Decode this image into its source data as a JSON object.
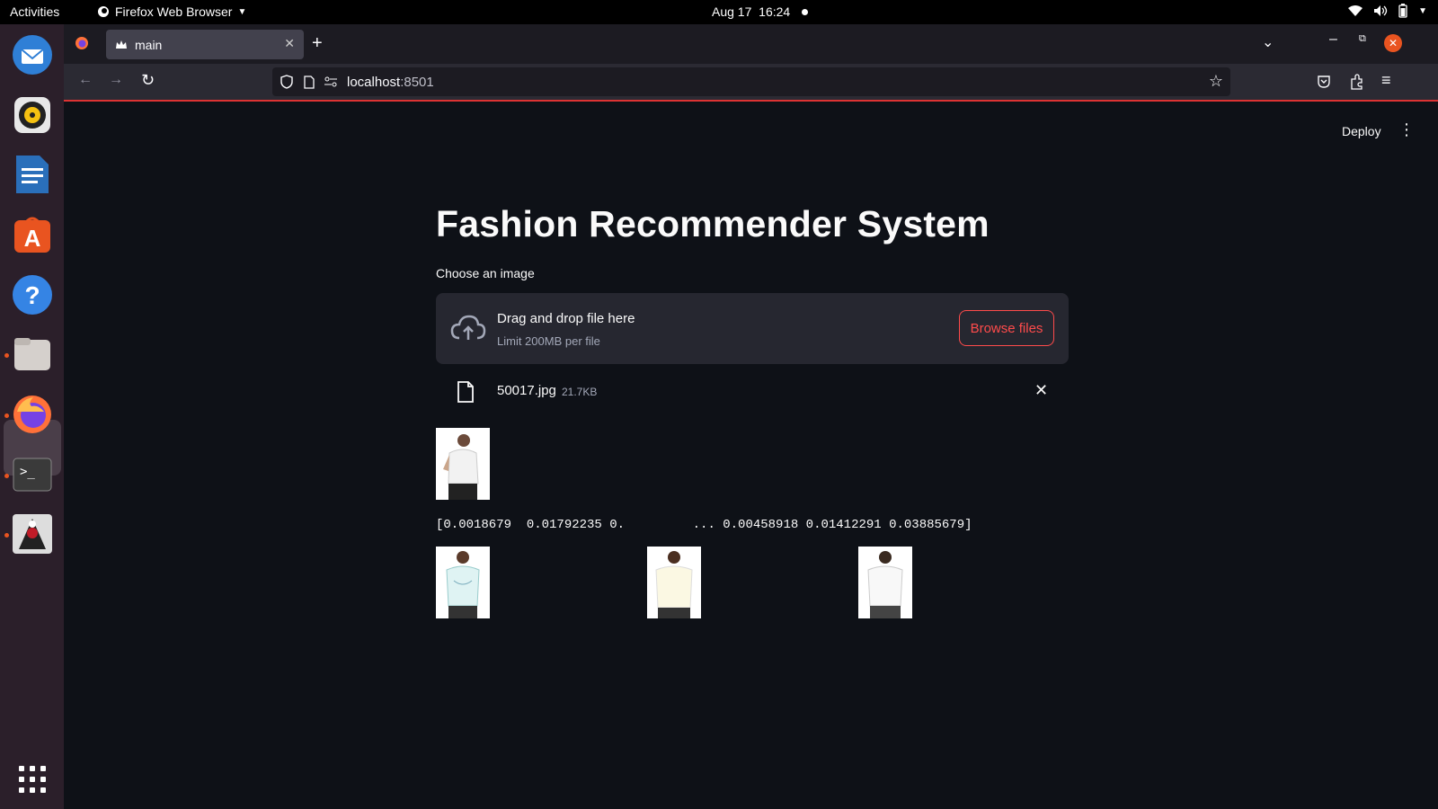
{
  "topbar": {
    "activities": "Activities",
    "app_menu": "Firefox Web Browser",
    "date": "Aug 17",
    "time": "16:24"
  },
  "dock": {
    "items": [
      "thunderbird-icon",
      "rhythmbox-icon",
      "writer-icon",
      "app-center-icon",
      "help-icon",
      "files-icon",
      "firefox-icon",
      "terminal-icon",
      "netbeans-icon",
      "app-grid-icon"
    ]
  },
  "browser": {
    "tab_title": "main",
    "url_host": "localhost",
    "url_port": ":8501"
  },
  "app": {
    "deploy_label": "Deploy",
    "title": "Fashion Recommender System",
    "uploader": {
      "label": "Choose an image",
      "drop_text": "Drag and drop file here",
      "limit_text": "Limit 200MB per file",
      "browse_label": "Browse files"
    },
    "uploaded_file": {
      "name": "50017.jpg",
      "size": "21.7KB"
    },
    "feature_vector": "[0.0018679  0.01792235 0.         ... 0.00458918 0.01412291 0.03885679]",
    "recommendations": [
      "recommended-shirt-1",
      "recommended-shirt-2",
      "recommended-shirt-3"
    ]
  },
  "colors": {
    "background": "#0e1117",
    "secondary_bg": "#262730",
    "accent": "#ff4b4b"
  }
}
